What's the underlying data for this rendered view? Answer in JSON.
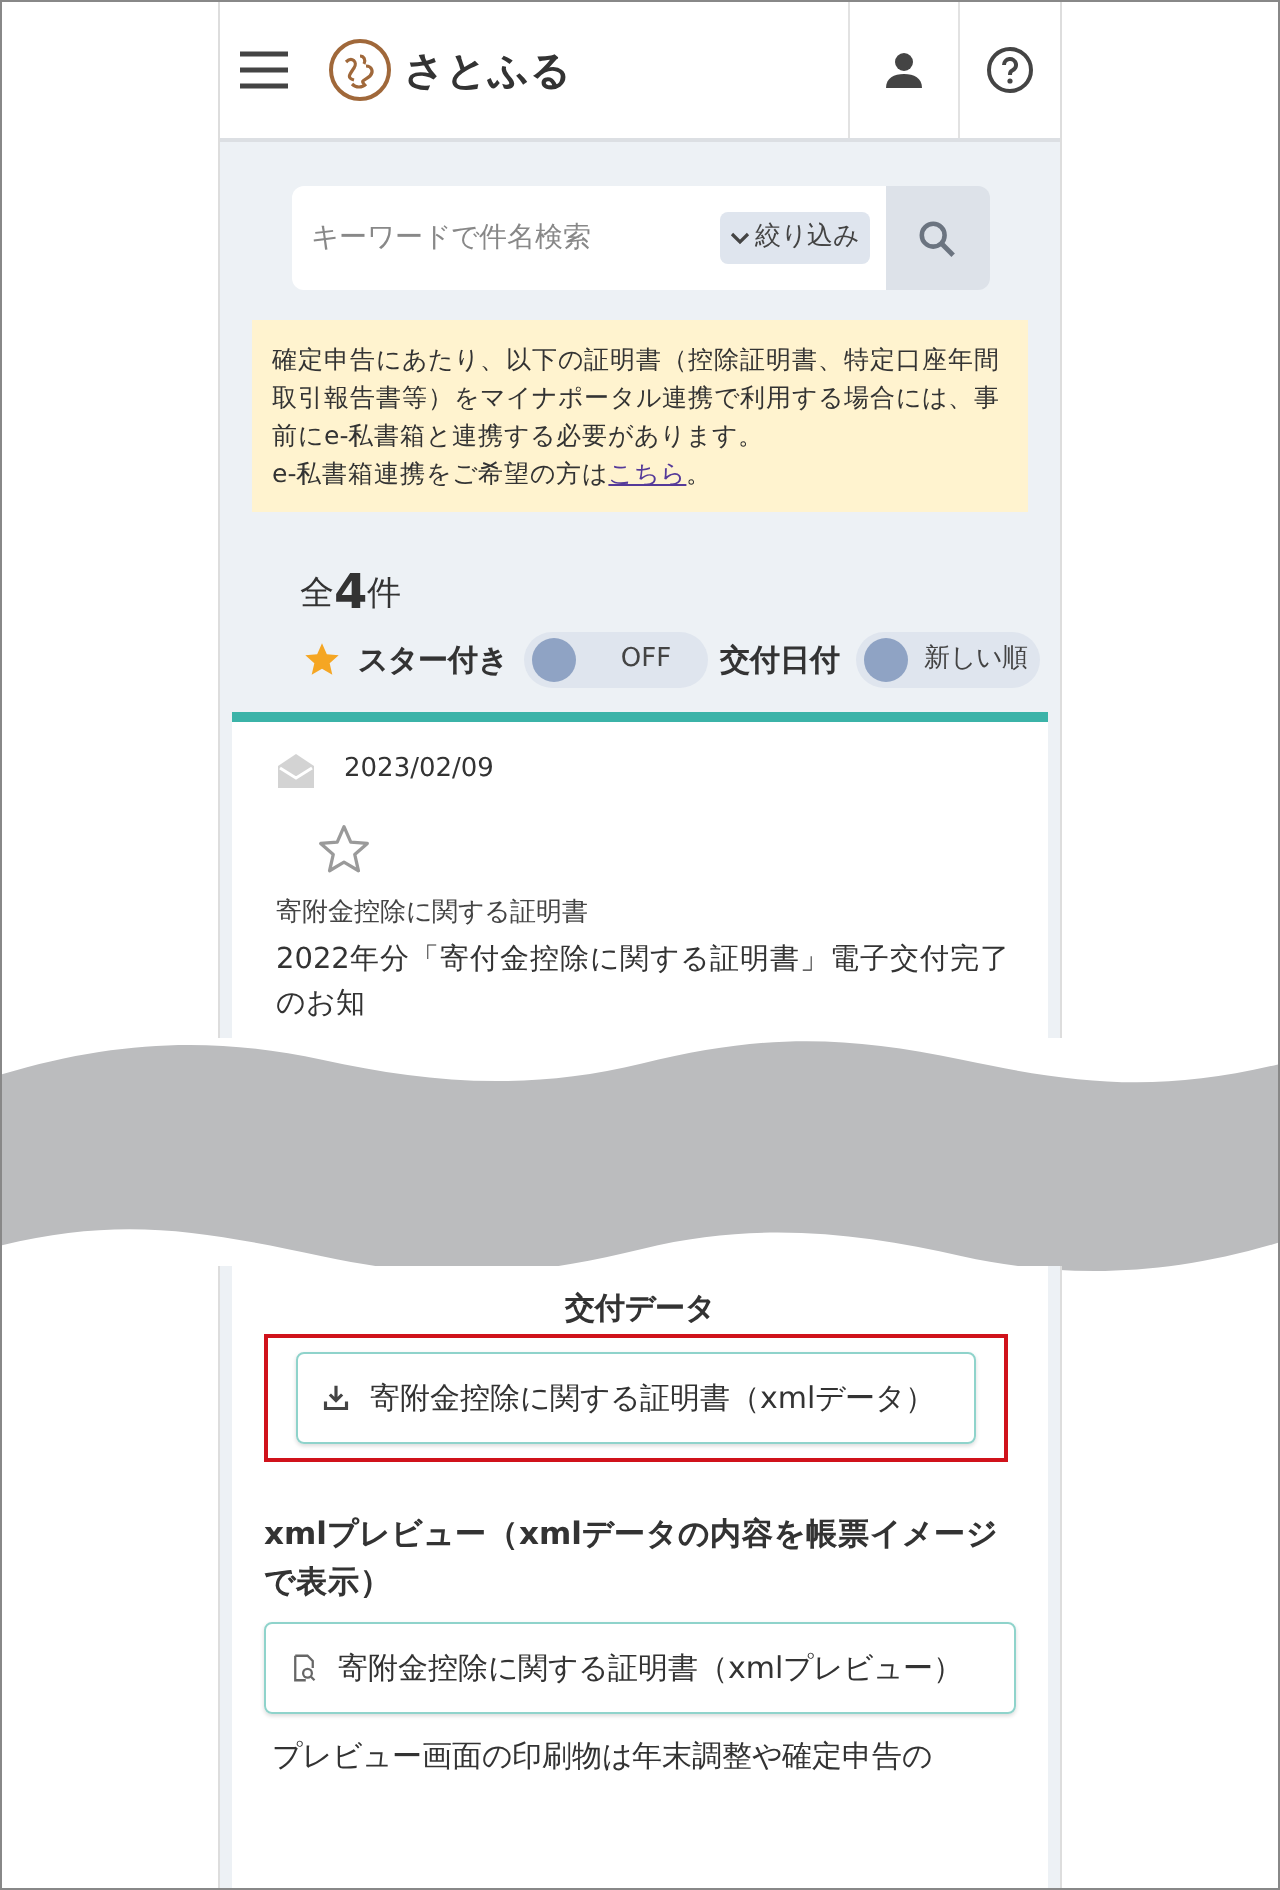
{
  "header": {
    "brand": "さとふる"
  },
  "search": {
    "placeholder": "キーワードで件名検索",
    "filter_button": "絞り込み"
  },
  "notice": {
    "text": "確定申告にあたり、以下の証明書（控除証明書、特定口座年間取引報告書等）をマイナポータル連携で利用する場合には、事前にe-私書箱と連携する必要があります。",
    "link_prefix": "e-私書箱連携をご希望の方は",
    "link": "こちら",
    "link_suffix": "。"
  },
  "count": {
    "prefix": "全",
    "number": "4",
    "suffix": "件"
  },
  "filters": [
    {
      "kind": "toggle",
      "label": "スター付き",
      "value": "OFF",
      "on": false
    },
    {
      "kind": "sort",
      "label": "交付日付",
      "value": "新しい順",
      "on": false
    }
  ],
  "message": {
    "date": "2023/02/09",
    "starred": false,
    "category": "寄附金控除に関する証明書",
    "title": "2022年分「寄付金控除に関する証明書」電子交付完了のお知"
  },
  "delivery": {
    "heading": "交付データ",
    "download_button": "寄附金控除に関する証明書（xmlデータ）"
  },
  "preview": {
    "heading": "xmlプレビュー（xmlデータの内容を帳票イメージで表示）",
    "button": "寄附金控除に関する証明書（xmlプレビュー）",
    "note": "プレビュー画面の印刷物は年末調整や確定申告の"
  }
}
